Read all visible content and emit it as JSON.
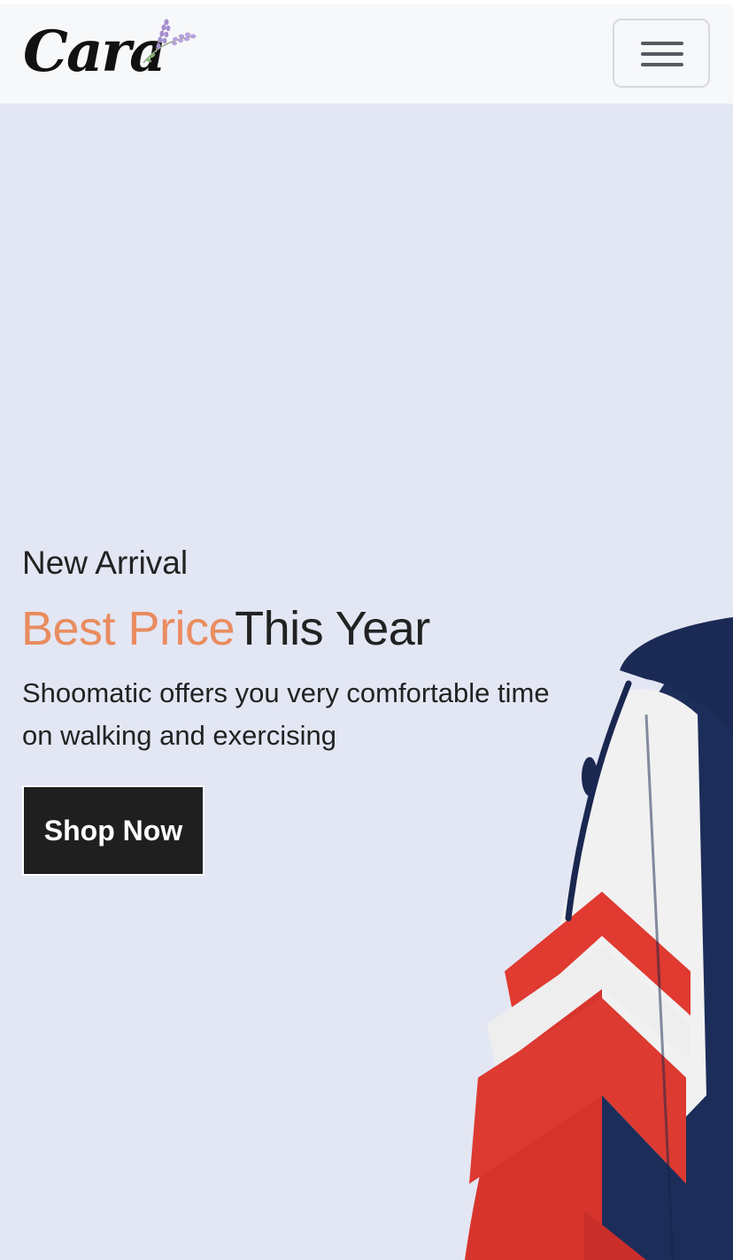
{
  "header": {
    "logo_text": "Cara",
    "menu_icon": "hamburger-icon"
  },
  "hero": {
    "eyebrow": "New Arrival",
    "headline_accent": "Best Price",
    "headline_rest": "This Year",
    "description": "Shoomatic offers you very comfortable time on walking and exercising",
    "cta_label": "Shop Now"
  },
  "colors": {
    "hero_background": "#e3e6f3",
    "navbar_background": "#f7f8fa",
    "accent": "#e98c5f",
    "button_background": "#1f1f1f"
  }
}
